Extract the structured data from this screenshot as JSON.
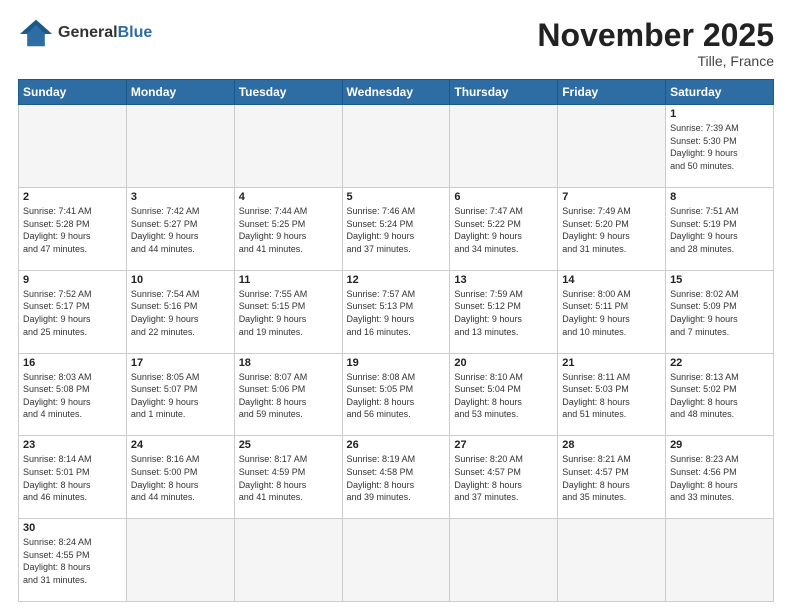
{
  "header": {
    "logo_general": "General",
    "logo_blue": "Blue",
    "month_title": "November 2025",
    "subtitle": "Tille, France"
  },
  "weekdays": [
    "Sunday",
    "Monday",
    "Tuesday",
    "Wednesday",
    "Thursday",
    "Friday",
    "Saturday"
  ],
  "days": [
    {
      "num": "",
      "info": ""
    },
    {
      "num": "",
      "info": ""
    },
    {
      "num": "",
      "info": ""
    },
    {
      "num": "",
      "info": ""
    },
    {
      "num": "",
      "info": ""
    },
    {
      "num": "",
      "info": ""
    },
    {
      "num": "1",
      "info": "Sunrise: 7:39 AM\nSunset: 5:30 PM\nDaylight: 9 hours\nand 50 minutes."
    },
    {
      "num": "2",
      "info": "Sunrise: 7:41 AM\nSunset: 5:28 PM\nDaylight: 9 hours\nand 47 minutes."
    },
    {
      "num": "3",
      "info": "Sunrise: 7:42 AM\nSunset: 5:27 PM\nDaylight: 9 hours\nand 44 minutes."
    },
    {
      "num": "4",
      "info": "Sunrise: 7:44 AM\nSunset: 5:25 PM\nDaylight: 9 hours\nand 41 minutes."
    },
    {
      "num": "5",
      "info": "Sunrise: 7:46 AM\nSunset: 5:24 PM\nDaylight: 9 hours\nand 37 minutes."
    },
    {
      "num": "6",
      "info": "Sunrise: 7:47 AM\nSunset: 5:22 PM\nDaylight: 9 hours\nand 34 minutes."
    },
    {
      "num": "7",
      "info": "Sunrise: 7:49 AM\nSunset: 5:20 PM\nDaylight: 9 hours\nand 31 minutes."
    },
    {
      "num": "8",
      "info": "Sunrise: 7:51 AM\nSunset: 5:19 PM\nDaylight: 9 hours\nand 28 minutes."
    },
    {
      "num": "9",
      "info": "Sunrise: 7:52 AM\nSunset: 5:17 PM\nDaylight: 9 hours\nand 25 minutes."
    },
    {
      "num": "10",
      "info": "Sunrise: 7:54 AM\nSunset: 5:16 PM\nDaylight: 9 hours\nand 22 minutes."
    },
    {
      "num": "11",
      "info": "Sunrise: 7:55 AM\nSunset: 5:15 PM\nDaylight: 9 hours\nand 19 minutes."
    },
    {
      "num": "12",
      "info": "Sunrise: 7:57 AM\nSunset: 5:13 PM\nDaylight: 9 hours\nand 16 minutes."
    },
    {
      "num": "13",
      "info": "Sunrise: 7:59 AM\nSunset: 5:12 PM\nDaylight: 9 hours\nand 13 minutes."
    },
    {
      "num": "14",
      "info": "Sunrise: 8:00 AM\nSunset: 5:11 PM\nDaylight: 9 hours\nand 10 minutes."
    },
    {
      "num": "15",
      "info": "Sunrise: 8:02 AM\nSunset: 5:09 PM\nDaylight: 9 hours\nand 7 minutes."
    },
    {
      "num": "16",
      "info": "Sunrise: 8:03 AM\nSunset: 5:08 PM\nDaylight: 9 hours\nand 4 minutes."
    },
    {
      "num": "17",
      "info": "Sunrise: 8:05 AM\nSunset: 5:07 PM\nDaylight: 9 hours\nand 1 minute."
    },
    {
      "num": "18",
      "info": "Sunrise: 8:07 AM\nSunset: 5:06 PM\nDaylight: 8 hours\nand 59 minutes."
    },
    {
      "num": "19",
      "info": "Sunrise: 8:08 AM\nSunset: 5:05 PM\nDaylight: 8 hours\nand 56 minutes."
    },
    {
      "num": "20",
      "info": "Sunrise: 8:10 AM\nSunset: 5:04 PM\nDaylight: 8 hours\nand 53 minutes."
    },
    {
      "num": "21",
      "info": "Sunrise: 8:11 AM\nSunset: 5:03 PM\nDaylight: 8 hours\nand 51 minutes."
    },
    {
      "num": "22",
      "info": "Sunrise: 8:13 AM\nSunset: 5:02 PM\nDaylight: 8 hours\nand 48 minutes."
    },
    {
      "num": "23",
      "info": "Sunrise: 8:14 AM\nSunset: 5:01 PM\nDaylight: 8 hours\nand 46 minutes."
    },
    {
      "num": "24",
      "info": "Sunrise: 8:16 AM\nSunset: 5:00 PM\nDaylight: 8 hours\nand 44 minutes."
    },
    {
      "num": "25",
      "info": "Sunrise: 8:17 AM\nSunset: 4:59 PM\nDaylight: 8 hours\nand 41 minutes."
    },
    {
      "num": "26",
      "info": "Sunrise: 8:19 AM\nSunset: 4:58 PM\nDaylight: 8 hours\nand 39 minutes."
    },
    {
      "num": "27",
      "info": "Sunrise: 8:20 AM\nSunset: 4:57 PM\nDaylight: 8 hours\nand 37 minutes."
    },
    {
      "num": "28",
      "info": "Sunrise: 8:21 AM\nSunset: 4:57 PM\nDaylight: 8 hours\nand 35 minutes."
    },
    {
      "num": "29",
      "info": "Sunrise: 8:23 AM\nSunset: 4:56 PM\nDaylight: 8 hours\nand 33 minutes."
    },
    {
      "num": "30",
      "info": "Sunrise: 8:24 AM\nSunset: 4:55 PM\nDaylight: 8 hours\nand 31 minutes."
    },
    {
      "num": "",
      "info": ""
    },
    {
      "num": "",
      "info": ""
    },
    {
      "num": "",
      "info": ""
    },
    {
      "num": "",
      "info": ""
    },
    {
      "num": "",
      "info": ""
    },
    {
      "num": "",
      "info": ""
    }
  ]
}
